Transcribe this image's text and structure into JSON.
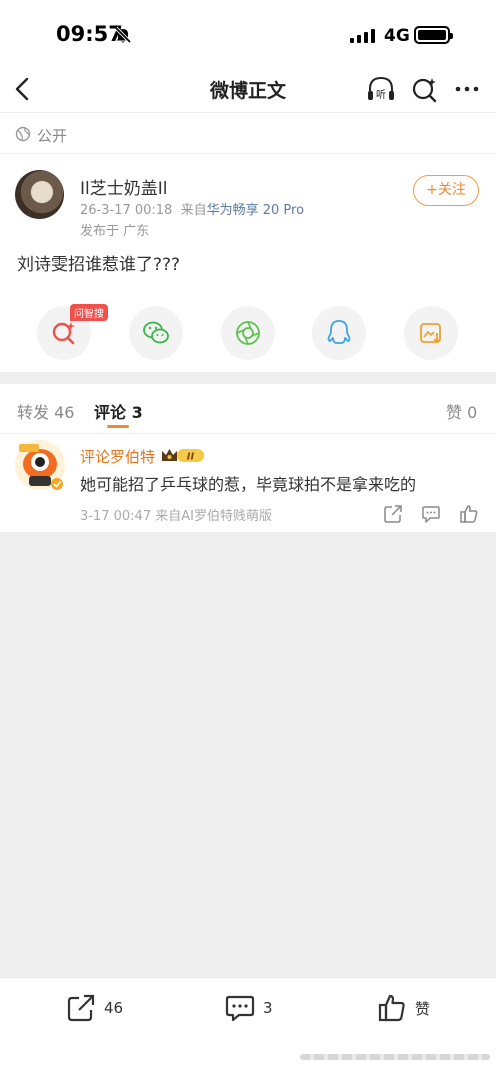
{
  "status_bar": {
    "time": "09:57",
    "network": "4G"
  },
  "nav": {
    "title": "微博正文"
  },
  "visibility": {
    "label": "公开"
  },
  "post": {
    "username": "Il芝士奶盖Il",
    "date": "26-3-17 00:18",
    "source_prefix": "来自",
    "device": "华为畅享 20 Pro",
    "location": "发布于 广东",
    "follow_label": "+关注",
    "text": "刘诗雯招谁惹谁了???",
    "search_badge": "问智搜"
  },
  "tabs": {
    "repost": "转发 46",
    "comments": "评论 3",
    "likes": "赞 0"
  },
  "comment": {
    "name": "评论罗伯特",
    "level": "II",
    "text": "她可能招了乒乓球的惹，毕竟球拍不是拿来吃的",
    "meta": "3-17 00:47  来自AI罗伯特贱萌版"
  },
  "bottom_bar": {
    "repost_count": "46",
    "comment_count": "3",
    "like_label": "赞"
  },
  "colors": {
    "accent": "#f08a2d",
    "link": "#5b7ba6",
    "badge": "#f0514c"
  }
}
